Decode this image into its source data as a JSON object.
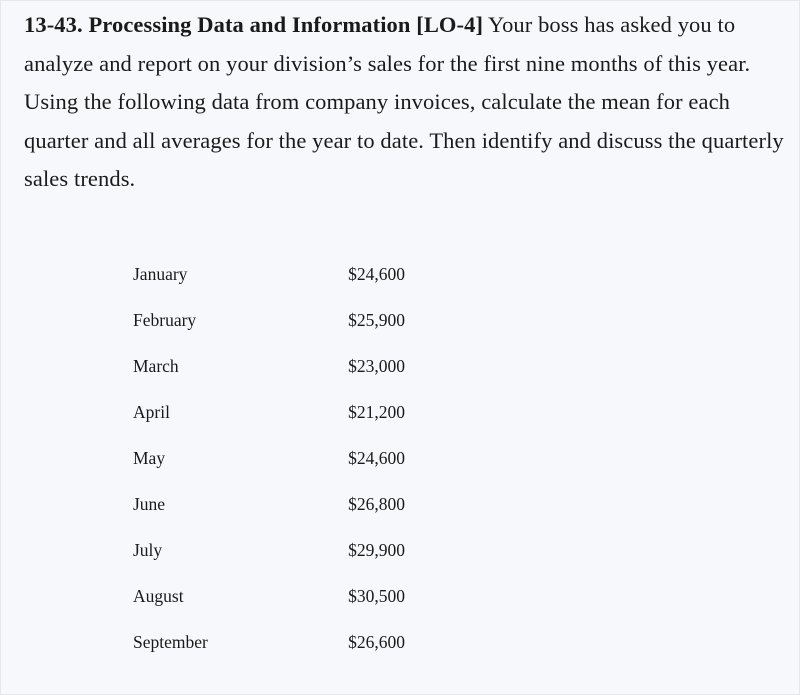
{
  "problem": {
    "heading": "13-43. Processing Data and Information [LO-4]",
    "body": "Your boss has asked you to analyze and report on your division’s sales for the first nine months of this year. Using the following data from company invoices, calculate the mean for each quarter and all averages for the year to date. Then identify and discuss the quarterly sales trends."
  },
  "sales": [
    {
      "month": "January",
      "amount": "$24,600"
    },
    {
      "month": "February",
      "amount": "$25,900"
    },
    {
      "month": "March",
      "amount": "$23,000"
    },
    {
      "month": "April",
      "amount": "$21,200"
    },
    {
      "month": "May",
      "amount": "$24,600"
    },
    {
      "month": "June",
      "amount": "$26,800"
    },
    {
      "month": "July",
      "amount": "$29,900"
    },
    {
      "month": "August",
      "amount": "$30,500"
    },
    {
      "month": "September",
      "amount": "$26,600"
    }
  ]
}
